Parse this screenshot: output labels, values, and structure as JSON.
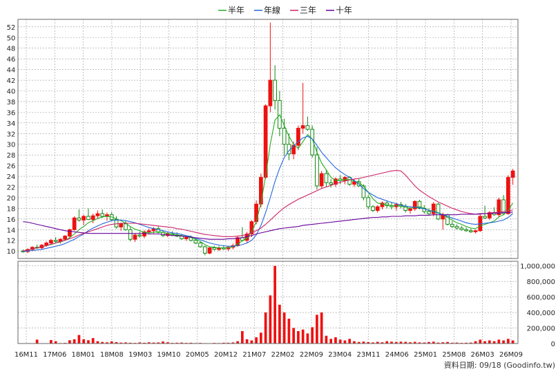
{
  "legend": [
    {
      "label": "半年",
      "color": "#22aa22"
    },
    {
      "label": "年線",
      "color": "#2266dd"
    },
    {
      "label": "三年",
      "color": "#cc2266"
    },
    {
      "label": "十年",
      "color": "#660099"
    }
  ],
  "footer": "資料日期: 09/18  (Goodinfo.tw)",
  "colors": {
    "up": "#ee1111",
    "down": "#118811",
    "grid": "#999999",
    "volume": "#ee1111"
  },
  "chart_data": {
    "type": "candlestick",
    "price_axis": {
      "ticks": [
        10,
        12,
        14,
        16,
        18,
        20,
        22,
        24,
        26,
        28,
        30,
        32,
        34,
        36,
        38,
        40,
        42,
        44,
        46,
        48,
        50,
        52
      ],
      "ylim": [
        8.6,
        53.4
      ],
      "side": "left"
    },
    "volume_axis": {
      "ticks": [
        0,
        200000,
        400000,
        600000,
        800000,
        1000000
      ],
      "tick_labels": [
        "0",
        "200,000",
        "400,000",
        "600,000",
        "800,000",
        "1,000,000"
      ],
      "ylim": [
        0,
        1060000
      ],
      "side": "right"
    },
    "x_tick_labels": [
      "16M11",
      "17M06",
      "18M01",
      "18M08",
      "19M03",
      "19M10",
      "20M05",
      "20M12",
      "21M07",
      "22M02",
      "22M09",
      "23M04",
      "23M11",
      "24M06",
      "25M01",
      "25M08",
      "26M03",
      "26M09"
    ],
    "grid": true,
    "legend_position": "top-center",
    "candles": [
      [
        10.0,
        10.3,
        9.7,
        9.9
      ],
      [
        9.9,
        10.5,
        9.6,
        10.3
      ],
      [
        10.3,
        10.9,
        10.0,
        10.7
      ],
      [
        10.7,
        11.2,
        10.4,
        10.6
      ],
      [
        10.6,
        11.3,
        10.3,
        11.1
      ],
      [
        11.1,
        11.8,
        10.8,
        11.5
      ],
      [
        11.5,
        12.3,
        11.2,
        12.0
      ],
      [
        12.0,
        12.6,
        11.5,
        11.8
      ],
      [
        11.8,
        12.4,
        11.4,
        12.2
      ],
      [
        12.2,
        13.0,
        11.9,
        12.8
      ],
      [
        12.8,
        14.2,
        12.5,
        14.0
      ],
      [
        14.0,
        16.5,
        13.8,
        16.2
      ],
      [
        16.2,
        17.8,
        15.5,
        15.8
      ],
      [
        15.8,
        16.8,
        14.9,
        16.5
      ],
      [
        16.5,
        18.0,
        15.8,
        15.9
      ],
      [
        15.9,
        17.0,
        15.2,
        16.6
      ],
      [
        16.6,
        17.6,
        16.0,
        17.0
      ],
      [
        17.0,
        17.8,
        16.2,
        16.5
      ],
      [
        16.5,
        17.2,
        15.7,
        16.8
      ],
      [
        16.8,
        17.3,
        15.6,
        15.9
      ],
      [
        15.9,
        16.5,
        14.2,
        14.5
      ],
      [
        14.5,
        15.3,
        13.8,
        15.1
      ],
      [
        15.1,
        15.6,
        13.8,
        14.0
      ],
      [
        14.0,
        14.5,
        11.8,
        12.2
      ],
      [
        12.2,
        13.3,
        11.7,
        13.0
      ],
      [
        13.0,
        13.6,
        12.5,
        12.8
      ],
      [
        12.8,
        13.9,
        12.4,
        13.6
      ],
      [
        13.6,
        14.2,
        13.1,
        13.8
      ],
      [
        13.8,
        14.5,
        13.3,
        14.2
      ],
      [
        14.2,
        14.6,
        13.3,
        13.5
      ],
      [
        13.5,
        13.9,
        12.6,
        12.9
      ],
      [
        12.9,
        13.6,
        12.6,
        13.2
      ],
      [
        13.2,
        13.7,
        12.8,
        13.0
      ],
      [
        13.0,
        13.5,
        12.6,
        12.8
      ],
      [
        12.8,
        13.1,
        12.1,
        12.3
      ],
      [
        12.3,
        12.8,
        11.9,
        12.6
      ],
      [
        12.6,
        12.9,
        11.8,
        12.0
      ],
      [
        12.0,
        12.3,
        11.3,
        11.5
      ],
      [
        11.5,
        11.8,
        10.6,
        10.8
      ],
      [
        10.8,
        11.0,
        9.2,
        9.6
      ],
      [
        9.6,
        10.8,
        9.4,
        10.6
      ],
      [
        10.6,
        11.0,
        10.1,
        10.3
      ],
      [
        10.3,
        10.9,
        10.0,
        10.6
      ],
      [
        10.6,
        11.1,
        10.2,
        10.4
      ],
      [
        10.4,
        10.9,
        10.0,
        10.7
      ],
      [
        10.7,
        11.4,
        10.3,
        11.0
      ],
      [
        11.0,
        12.8,
        10.8,
        12.5
      ],
      [
        12.5,
        14.5,
        11.8,
        12.0
      ],
      [
        12.0,
        13.6,
        11.5,
        13.2
      ],
      [
        13.2,
        15.8,
        12.6,
        15.5
      ],
      [
        15.5,
        19.5,
        15.0,
        18.8
      ],
      [
        18.8,
        24.5,
        18.2,
        23.8
      ],
      [
        23.8,
        37.5,
        23.5,
        37.2
      ],
      [
        37.2,
        52.8,
        36.0,
        42.0
      ],
      [
        42.0,
        44.8,
        36.5,
        38.2
      ],
      [
        38.2,
        40.0,
        31.5,
        33.0
      ],
      [
        33.0,
        34.8,
        27.8,
        30.0
      ],
      [
        30.0,
        32.0,
        27.0,
        28.2
      ],
      [
        28.2,
        30.5,
        27.2,
        29.8
      ],
      [
        29.8,
        33.5,
        28.9,
        33.0
      ],
      [
        33.0,
        41.5,
        32.0,
        33.5
      ],
      [
        33.5,
        35.2,
        32.5,
        32.8
      ],
      [
        32.8,
        33.5,
        27.5,
        28.0
      ],
      [
        28.0,
        29.5,
        21.5,
        22.2
      ],
      [
        22.2,
        25.0,
        21.8,
        24.5
      ],
      [
        24.5,
        25.2,
        22.0,
        22.8
      ],
      [
        22.8,
        23.5,
        21.9,
        22.5
      ],
      [
        22.5,
        23.8,
        22.0,
        23.5
      ],
      [
        23.5,
        24.2,
        22.5,
        23.2
      ],
      [
        23.2,
        24.0,
        22.5,
        23.8
      ],
      [
        23.8,
        24.0,
        22.2,
        22.5
      ],
      [
        22.5,
        23.5,
        22.0,
        23.0
      ],
      [
        23.0,
        23.5,
        22.0,
        22.2
      ],
      [
        22.2,
        22.5,
        19.5,
        20.0
      ],
      [
        20.0,
        20.5,
        17.8,
        18.3
      ],
      [
        18.3,
        18.6,
        17.3,
        17.6
      ],
      [
        17.6,
        18.6,
        17.2,
        18.3
      ],
      [
        18.3,
        19.3,
        17.8,
        19.0
      ],
      [
        19.0,
        19.5,
        18.0,
        18.5
      ],
      [
        18.5,
        19.2,
        17.8,
        18.3
      ],
      [
        18.3,
        19.0,
        17.6,
        18.7
      ],
      [
        18.7,
        19.2,
        18.0,
        18.4
      ],
      [
        18.4,
        18.8,
        17.2,
        17.6
      ],
      [
        17.6,
        18.2,
        17.0,
        17.9
      ],
      [
        17.9,
        19.5,
        17.5,
        19.3
      ],
      [
        19.3,
        19.6,
        17.8,
        18.0
      ],
      [
        18.0,
        18.6,
        17.0,
        17.4
      ],
      [
        17.4,
        18.0,
        16.6,
        17.0
      ],
      [
        17.0,
        19.2,
        16.5,
        18.8
      ],
      [
        18.8,
        19.0,
        15.8,
        16.0
      ],
      [
        16.0,
        17.2,
        14.0,
        16.8
      ],
      [
        16.8,
        17.0,
        14.8,
        15.0
      ],
      [
        15.0,
        15.6,
        14.3,
        14.6
      ],
      [
        14.6,
        15.0,
        14.0,
        14.3
      ],
      [
        14.3,
        14.7,
        13.8,
        14.0
      ],
      [
        14.0,
        14.4,
        13.6,
        13.8
      ],
      [
        13.8,
        14.2,
        13.4,
        13.6
      ],
      [
        13.6,
        14.0,
        13.3,
        13.8
      ],
      [
        13.8,
        16.8,
        13.6,
        16.5
      ],
      [
        16.5,
        18.5,
        16.0,
        16.2
      ],
      [
        16.2,
        17.5,
        15.8,
        17.2
      ],
      [
        17.2,
        18.2,
        16.6,
        16.8
      ],
      [
        16.8,
        20.0,
        16.3,
        19.6
      ],
      [
        19.6,
        20.5,
        16.8,
        17.0
      ],
      [
        17.0,
        24.2,
        16.8,
        23.8
      ],
      [
        23.8,
        25.4,
        22.4,
        25.0
      ]
    ],
    "volumes": [
      3000,
      5000,
      4000,
      50000,
      2500,
      3500,
      45000,
      30000,
      6000,
      8000,
      42000,
      55000,
      110000,
      55000,
      42000,
      70000,
      30000,
      20000,
      16000,
      28000,
      18000,
      12000,
      14000,
      10000,
      8000,
      14000,
      10000,
      16000,
      12000,
      14000,
      26000,
      16000,
      8000,
      10000,
      12000,
      8000,
      10000,
      6000,
      8000,
      5000,
      4000,
      8000,
      6000,
      10000,
      10000,
      14000,
      30000,
      160000,
      55000,
      40000,
      80000,
      140000,
      400000,
      620000,
      1000000,
      500000,
      400000,
      320000,
      200000,
      160000,
      180000,
      130000,
      210000,
      370000,
      400000,
      100000,
      60000,
      80000,
      50000,
      40000,
      60000,
      30000,
      20000,
      25000,
      18000,
      14000,
      22000,
      16000,
      30000,
      24000,
      20000,
      24000,
      22000,
      16000,
      22000,
      14000,
      12000,
      20000,
      24000,
      12000,
      16000,
      20000,
      10000,
      12000,
      8000,
      10000,
      12000,
      30000,
      50000,
      30000,
      40000,
      30000,
      50000,
      40000,
      60000,
      40000
    ],
    "series": [
      {
        "name": "半年",
        "values": [
          10.0,
          10.2,
          10.4,
          10.6,
          10.8,
          11.0,
          11.2,
          11.5,
          11.7,
          12.0,
          12.5,
          13.2,
          14.0,
          14.6,
          15.3,
          15.7,
          16.1,
          16.4,
          16.5,
          16.4,
          16.0,
          15.7,
          15.2,
          14.6,
          14.1,
          13.8,
          13.5,
          13.4,
          13.5,
          13.6,
          13.5,
          13.3,
          13.2,
          13.0,
          12.9,
          12.7,
          12.5,
          12.2,
          11.8,
          11.2,
          10.8,
          10.7,
          10.6,
          10.6,
          10.6,
          10.8,
          11.3,
          11.9,
          12.4,
          13.6,
          15.5,
          19.0,
          24.0,
          30.0,
          34.5,
          35.5,
          33.5,
          31.5,
          30.0,
          29.2,
          30.5,
          31.8,
          31.0,
          28.5,
          26.5,
          25.2,
          23.8,
          23.2,
          23.2,
          23.4,
          23.4,
          23.1,
          22.8,
          22.1,
          21.0,
          19.8,
          19.0,
          18.8,
          18.7,
          18.5,
          18.5,
          18.4,
          18.2,
          18.0,
          18.2,
          18.3,
          18.0,
          17.6,
          17.5,
          17.2,
          16.8,
          16.3,
          15.8,
          15.3,
          15.0,
          14.6,
          14.3,
          14.2,
          14.7,
          15.0,
          15.3,
          15.6,
          16.4,
          16.8,
          17.6,
          19.0
        ]
      },
      {
        "name": "年線",
        "values": [
          9.9,
          10.0,
          10.1,
          10.2,
          10.3,
          10.5,
          10.7,
          10.9,
          11.1,
          11.4,
          11.8,
          12.2,
          12.7,
          13.2,
          13.8,
          14.3,
          14.7,
          15.1,
          15.4,
          15.7,
          15.8,
          15.8,
          15.7,
          15.5,
          15.3,
          15.0,
          14.7,
          14.4,
          14.2,
          14.0,
          13.8,
          13.6,
          13.4,
          13.3,
          13.1,
          12.9,
          12.7,
          12.4,
          12.1,
          11.8,
          11.5,
          11.3,
          11.1,
          11.0,
          10.9,
          10.9,
          11.0,
          11.2,
          11.5,
          12.0,
          13.0,
          14.8,
          17.2,
          20.0,
          23.0,
          25.5,
          27.5,
          28.8,
          29.7,
          30.5,
          31.2,
          31.5,
          31.0,
          29.8,
          28.5,
          27.5,
          26.5,
          25.6,
          24.9,
          24.3,
          23.8,
          23.2,
          22.5,
          21.7,
          21.0,
          20.5,
          20.0,
          19.7,
          19.4,
          19.1,
          18.9,
          18.6,
          18.4,
          18.3,
          18.2,
          18.1,
          17.9,
          17.6,
          17.4,
          17.1,
          16.8,
          16.5,
          16.2,
          15.9,
          15.6,
          15.3,
          15.1,
          15.0,
          15.1,
          15.2,
          15.3,
          15.4,
          15.6,
          15.8,
          16.3,
          17.0
        ]
      },
      {
        "name": "三年",
        "values": [
          10.0,
          10.2,
          10.4,
          10.6,
          10.8,
          11.0,
          11.3,
          11.5,
          11.8,
          12.0,
          12.3,
          12.6,
          13.0,
          13.3,
          13.6,
          13.9,
          14.2,
          14.5,
          14.8,
          15.0,
          15.1,
          15.2,
          15.2,
          15.2,
          15.2,
          15.1,
          15.0,
          14.9,
          14.8,
          14.7,
          14.6,
          14.5,
          14.4,
          14.2,
          14.1,
          13.9,
          13.7,
          13.5,
          13.3,
          13.1,
          13.0,
          12.9,
          12.8,
          12.7,
          12.7,
          12.7,
          12.8,
          12.9,
          13.1,
          13.4,
          13.8,
          14.3,
          15.0,
          15.8,
          16.6,
          17.4,
          18.1,
          18.7,
          19.2,
          19.7,
          20.1,
          20.5,
          20.9,
          21.3,
          21.7,
          22.0,
          22.3,
          22.6,
          22.9,
          23.1,
          23.3,
          23.5,
          23.6,
          23.8,
          24.0,
          24.2,
          24.4,
          24.6,
          24.8,
          25.0,
          25.1,
          25.0,
          24.2,
          23.2,
          22.2,
          21.4,
          20.8,
          20.2,
          19.7,
          19.2,
          18.8,
          18.4,
          18.0,
          17.7,
          17.4,
          17.2,
          17.0,
          16.9,
          16.9,
          17.0,
          17.1,
          17.2,
          17.3,
          17.4,
          17.5,
          17.7
        ]
      },
      {
        "name": "十年",
        "values": [
          15.5,
          15.4,
          15.2,
          15.0,
          14.8,
          14.6,
          14.4,
          14.2,
          14.0,
          13.8,
          13.7,
          13.6,
          13.5,
          13.4,
          13.3,
          13.3,
          13.3,
          13.3,
          13.3,
          13.3,
          13.3,
          13.3,
          13.3,
          13.3,
          13.3,
          13.3,
          13.3,
          13.2,
          13.2,
          13.2,
          13.1,
          13.0,
          12.9,
          12.9,
          12.8,
          12.7,
          12.6,
          12.5,
          12.4,
          12.3,
          12.2,
          12.2,
          12.2,
          12.2,
          12.3,
          12.3,
          12.4,
          12.5,
          12.7,
          12.9,
          13.2,
          13.4,
          13.6,
          13.8,
          14.0,
          14.2,
          14.3,
          14.4,
          14.5,
          14.6,
          14.8,
          14.9,
          15.0,
          15.1,
          15.2,
          15.3,
          15.4,
          15.5,
          15.6,
          15.7,
          15.8,
          15.9,
          16.0,
          16.1,
          16.2,
          16.3,
          16.3,
          16.4,
          16.4,
          16.5,
          16.5,
          16.5,
          16.6,
          16.6,
          16.6,
          16.7,
          16.7,
          16.7,
          16.8,
          16.8,
          16.8,
          16.8,
          16.8,
          16.8,
          16.9,
          16.9,
          16.9,
          16.9,
          17.0,
          17.0,
          17.0,
          17.1,
          17.1,
          17.2,
          17.2,
          17.3
        ]
      }
    ]
  }
}
